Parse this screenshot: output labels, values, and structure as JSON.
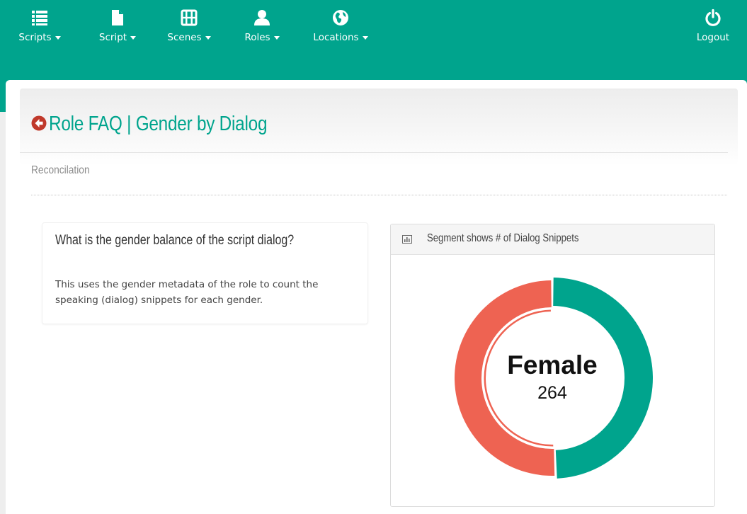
{
  "nav": {
    "items": [
      {
        "label": "Scripts",
        "icon": "list-icon"
      },
      {
        "label": "Script",
        "icon": "file-icon"
      },
      {
        "label": "Scenes",
        "icon": "film-icon"
      },
      {
        "label": "Roles",
        "icon": "user-icon"
      },
      {
        "label": "Locations",
        "icon": "globe-icon"
      }
    ],
    "logout": {
      "label": "Logout",
      "icon": "power-icon"
    }
  },
  "page": {
    "title": "Role FAQ | Gender by Dialog",
    "back_icon": "arrow-circle-left-icon",
    "subtitle": "Reconcilation"
  },
  "info": {
    "question": "What is the gender balance of the script dialog?",
    "description": "This uses the gender metadata of the role to count the speaking (dialog) snippets for each gender."
  },
  "chart_panel": {
    "header_icon": "bar-chart-icon",
    "header": "Segment shows # of Dialog Snippets"
  },
  "chart_data": {
    "type": "pie",
    "center_label": "Female",
    "center_value": "264",
    "slices": [
      {
        "value": 264,
        "color": "#00a48d"
      },
      {
        "value": 270,
        "color": "#ee6352"
      }
    ],
    "highlighted": 0
  },
  "colors": {
    "brand": "#00a48d",
    "accent_red": "#ee6352",
    "back_icon": "#c0392b"
  }
}
